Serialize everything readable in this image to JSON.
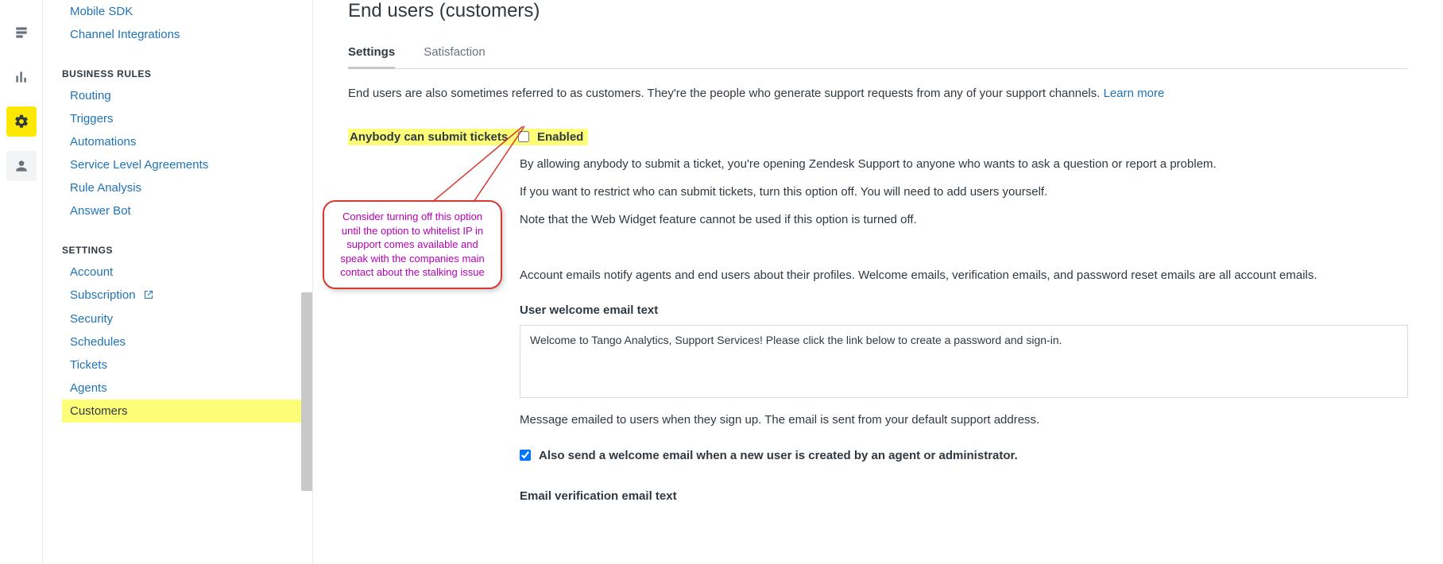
{
  "rail": {
    "items": [
      "views-icon",
      "reporting-icon",
      "admin-icon",
      "user-icon"
    ],
    "active_index": 2
  },
  "sidebar": {
    "top_links": [
      "Mobile SDK",
      "Channel Integrations"
    ],
    "section1_title": "BUSINESS RULES",
    "section1_items": [
      "Routing",
      "Triggers",
      "Automations",
      "Service Level Agreements",
      "Rule Analysis",
      "Answer Bot"
    ],
    "section2_title": "SETTINGS",
    "section2_items": [
      "Account",
      "Subscription",
      "Security",
      "Schedules",
      "Tickets",
      "Agents",
      "Customers"
    ],
    "subscription_external": true,
    "selected": "Customers"
  },
  "page": {
    "title": "End users (customers)",
    "tabs": [
      "Settings",
      "Satisfaction"
    ],
    "active_tab": 0,
    "intro_text": "End users are also sometimes referred to as customers. They're the people who generate support requests from any of your support channels. ",
    "learn_more": "Learn more",
    "row1_label": "Anybody can submit tickets",
    "row1_checkbox_label": "Enabled",
    "row1_checked": false,
    "row1_help1": "By allowing anybody to submit a ticket, you're opening Zendesk Support to anyone who wants to ask a question or report a problem.",
    "row1_help2": "If you want to restrict who can submit tickets, turn this option off. You will need to add users yourself.",
    "row1_help3": "Note that the Web Widget feature cannot be used if this option is turned off.",
    "account_emails_text": "Account emails notify agents and end users about their profiles. Welcome emails, verification emails, and password reset emails are all account emails.",
    "welcome_heading": "User welcome email text",
    "welcome_value": "Welcome to Tango Analytics, Support Services! Please click the link below to create a password and sign-in.",
    "welcome_caption": "Message emailed to users when they sign up. The email is sent from your default support address.",
    "also_send_label": "Also send a welcome email when a new user is created by an agent or administrator.",
    "also_send_checked": true,
    "verification_heading": "Email verification email text"
  },
  "callout": {
    "line1": "Consider turning off this option until the option to whitelist IP in support comes available and",
    "line2": "speak with the companies main contact about the stalking issue"
  }
}
